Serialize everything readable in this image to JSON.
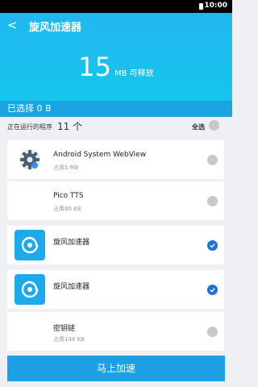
{
  "status_bar": {
    "time": "10:00"
  },
  "header": {
    "back_icon": "back-arrow-icon",
    "title": "旋风加速器"
  },
  "summary": {
    "amount": "15",
    "unit": "MB 可释放"
  },
  "selection": {
    "label": "已选择 0 B"
  },
  "running": {
    "label": "正在运行的程序",
    "count": "11 个",
    "select_all_label": "全选",
    "select_all_checked": false
  },
  "apps": [
    {
      "name": "Android System WebView",
      "memory": "占用5 MB",
      "icon": "gear-icon",
      "checked": false
    },
    {
      "name": "Pico TTS",
      "memory": "占用80 KB",
      "icon": "",
      "checked": false
    },
    {
      "name": "旋风加速器",
      "memory": "",
      "icon": "swirl-app-icon",
      "checked": true
    },
    {
      "name": "旋风加速器",
      "memory": "",
      "icon": "swirl-app-icon",
      "checked": true
    },
    {
      "name": "密钥链",
      "memory": "占用148 KB",
      "icon": "",
      "checked": false
    }
  ],
  "action": {
    "label": "马上加速"
  },
  "colors": {
    "header": "#22b7ef",
    "selection_bar": "#1aa5e2",
    "checked": "#1d74d6",
    "button": "#1da0e6"
  }
}
